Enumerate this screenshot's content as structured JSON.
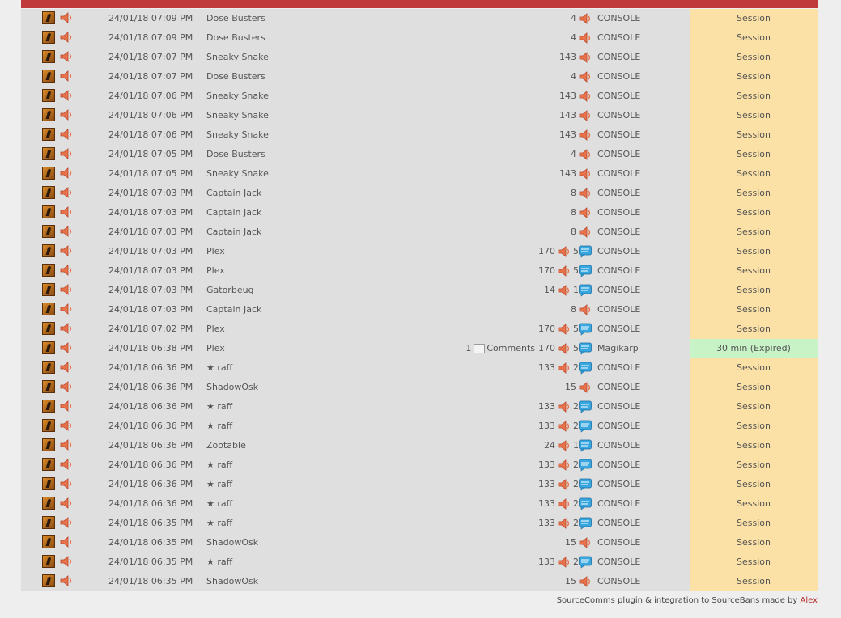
{
  "colors": {
    "header_bar": "#c0393b",
    "table_bg": "#dfdfdf",
    "session_bg": "#fce1a6",
    "expired_bg": "#c7f3c7",
    "author_link": "#b42b2b"
  },
  "icons": {
    "game": "game-icon",
    "mute": "mute-speaker-icon",
    "gag": "chat-bubble-icon"
  },
  "rows": [
    {
      "date": "24/01/18 07:09 PM",
      "name": "Dose Busters",
      "mute_count": "4",
      "gag_count": "",
      "admin": "CONSOLE",
      "length": "Session",
      "comments": ""
    },
    {
      "date": "24/01/18 07:09 PM",
      "name": "Dose Busters",
      "mute_count": "4",
      "gag_count": "",
      "admin": "CONSOLE",
      "length": "Session",
      "comments": ""
    },
    {
      "date": "24/01/18 07:07 PM",
      "name": "Sneaky Snake",
      "mute_count": "143",
      "gag_count": "",
      "admin": "CONSOLE",
      "length": "Session",
      "comments": ""
    },
    {
      "date": "24/01/18 07:07 PM",
      "name": "Dose Busters",
      "mute_count": "4",
      "gag_count": "",
      "admin": "CONSOLE",
      "length": "Session",
      "comments": ""
    },
    {
      "date": "24/01/18 07:06 PM",
      "name": "Sneaky Snake",
      "mute_count": "143",
      "gag_count": "",
      "admin": "CONSOLE",
      "length": "Session",
      "comments": ""
    },
    {
      "date": "24/01/18 07:06 PM",
      "name": "Sneaky Snake",
      "mute_count": "143",
      "gag_count": "",
      "admin": "CONSOLE",
      "length": "Session",
      "comments": ""
    },
    {
      "date": "24/01/18 07:06 PM",
      "name": "Sneaky Snake",
      "mute_count": "143",
      "gag_count": "",
      "admin": "CONSOLE",
      "length": "Session",
      "comments": ""
    },
    {
      "date": "24/01/18 07:05 PM",
      "name": "Dose Busters",
      "mute_count": "4",
      "gag_count": "",
      "admin": "CONSOLE",
      "length": "Session",
      "comments": ""
    },
    {
      "date": "24/01/18 07:05 PM",
      "name": "Sneaky Snake",
      "mute_count": "143",
      "gag_count": "",
      "admin": "CONSOLE",
      "length": "Session",
      "comments": ""
    },
    {
      "date": "24/01/18 07:03 PM",
      "name": "Captain Jack",
      "mute_count": "8",
      "gag_count": "",
      "admin": "CONSOLE",
      "length": "Session",
      "comments": ""
    },
    {
      "date": "24/01/18 07:03 PM",
      "name": "Captain Jack",
      "mute_count": "8",
      "gag_count": "",
      "admin": "CONSOLE",
      "length": "Session",
      "comments": ""
    },
    {
      "date": "24/01/18 07:03 PM",
      "name": "Captain Jack",
      "mute_count": "8",
      "gag_count": "",
      "admin": "CONSOLE",
      "length": "Session",
      "comments": ""
    },
    {
      "date": "24/01/18 07:03 PM",
      "name": "Plex",
      "mute_count": "170",
      "gag_count": "5",
      "admin": "CONSOLE",
      "length": "Session",
      "comments": ""
    },
    {
      "date": "24/01/18 07:03 PM",
      "name": "Plex",
      "mute_count": "170",
      "gag_count": "5",
      "admin": "CONSOLE",
      "length": "Session",
      "comments": ""
    },
    {
      "date": "24/01/18 07:03 PM",
      "name": "Gatorbeug",
      "mute_count": "14",
      "gag_count": "1",
      "admin": "CONSOLE",
      "length": "Session",
      "comments": ""
    },
    {
      "date": "24/01/18 07:03 PM",
      "name": "Captain Jack",
      "mute_count": "8",
      "gag_count": "",
      "admin": "CONSOLE",
      "length": "Session",
      "comments": ""
    },
    {
      "date": "24/01/18 07:02 PM",
      "name": "Plex",
      "mute_count": "170",
      "gag_count": "5",
      "admin": "CONSOLE",
      "length": "Session",
      "comments": ""
    },
    {
      "date": "24/01/18 06:38 PM",
      "name": "Plex",
      "mute_count": "170",
      "gag_count": "5",
      "admin": "Magikarp",
      "length": "30 min (Expired)",
      "comments": "1",
      "comments_alt": "Comments",
      "expired": true
    },
    {
      "date": "24/01/18 06:36 PM",
      "name": "★ raff",
      "mute_count": "133",
      "gag_count": "2",
      "admin": "CONSOLE",
      "length": "Session",
      "comments": ""
    },
    {
      "date": "24/01/18 06:36 PM",
      "name": "ShadowOsk",
      "mute_count": "15",
      "gag_count": "",
      "admin": "CONSOLE",
      "length": "Session",
      "comments": ""
    },
    {
      "date": "24/01/18 06:36 PM",
      "name": "★ raff",
      "mute_count": "133",
      "gag_count": "2",
      "admin": "CONSOLE",
      "length": "Session",
      "comments": ""
    },
    {
      "date": "24/01/18 06:36 PM",
      "name": "★ raff",
      "mute_count": "133",
      "gag_count": "2",
      "admin": "CONSOLE",
      "length": "Session",
      "comments": ""
    },
    {
      "date": "24/01/18 06:36 PM",
      "name": "Zootable",
      "mute_count": "24",
      "gag_count": "1",
      "admin": "CONSOLE",
      "length": "Session",
      "comments": ""
    },
    {
      "date": "24/01/18 06:36 PM",
      "name": "★ raff",
      "mute_count": "133",
      "gag_count": "2",
      "admin": "CONSOLE",
      "length": "Session",
      "comments": ""
    },
    {
      "date": "24/01/18 06:36 PM",
      "name": "★ raff",
      "mute_count": "133",
      "gag_count": "2",
      "admin": "CONSOLE",
      "length": "Session",
      "comments": ""
    },
    {
      "date": "24/01/18 06:36 PM",
      "name": "★ raff",
      "mute_count": "133",
      "gag_count": "2",
      "admin": "CONSOLE",
      "length": "Session",
      "comments": ""
    },
    {
      "date": "24/01/18 06:35 PM",
      "name": "★ raff",
      "mute_count": "133",
      "gag_count": "2",
      "admin": "CONSOLE",
      "length": "Session",
      "comments": ""
    },
    {
      "date": "24/01/18 06:35 PM",
      "name": "ShadowOsk",
      "mute_count": "15",
      "gag_count": "",
      "admin": "CONSOLE",
      "length": "Session",
      "comments": ""
    },
    {
      "date": "24/01/18 06:35 PM",
      "name": "★ raff",
      "mute_count": "133",
      "gag_count": "2",
      "admin": "CONSOLE",
      "length": "Session",
      "comments": ""
    },
    {
      "date": "24/01/18 06:35 PM",
      "name": "ShadowOsk",
      "mute_count": "15",
      "gag_count": "",
      "admin": "CONSOLE",
      "length": "Session",
      "comments": ""
    }
  ],
  "footer": {
    "text": "SourceComms plugin & integration to SourceBans made by ",
    "author": "Alex"
  }
}
